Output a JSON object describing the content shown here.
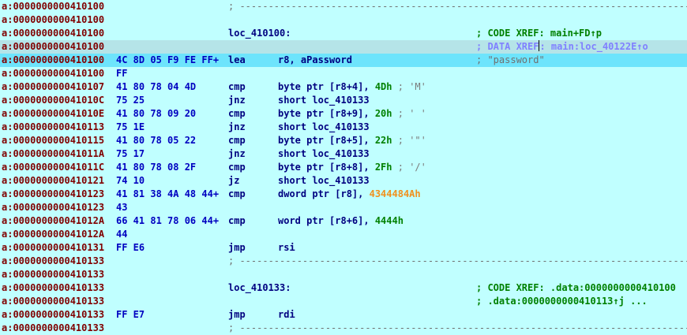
{
  "lines": [
    {
      "addr": "a:0000000000410100",
      "kind": "sep",
      "text": "; -----------------------------------------------------------------------------------"
    },
    {
      "addr": "a:0000000000410100"
    },
    {
      "addr": "a:0000000000410100",
      "label": "loc_410100:",
      "comment": "; CODE XREF: main+FD↑p"
    },
    {
      "addr": "a:0000000000410100",
      "comment_pre": "; DATA XREF",
      "comment_post": ": main:loc_40122E↑o",
      "comment_style": "dataxref",
      "highlight": "faint"
    },
    {
      "addr": "a:0000000000410100",
      "bytes": "4C 8D 05 F9 FE FF+",
      "mnem": "lea",
      "ops": "r8, aPassword",
      "comment": "; \"password\"",
      "comment_style": "gray",
      "highlight": "current"
    },
    {
      "addr": "a:0000000000410100",
      "bytes": "FF"
    },
    {
      "addr": "a:0000000000410107",
      "bytes": "41 80 78 04 4D",
      "mnem": "cmp",
      "ops": "byte ptr [r8+4], ",
      "imm": "4Dh",
      "inline": " ; 'M'"
    },
    {
      "addr": "a:000000000041010C",
      "bytes": "75 25",
      "mnem": "jnz",
      "ops": "short loc_410133"
    },
    {
      "addr": "a:000000000041010E",
      "bytes": "41 80 78 09 20",
      "mnem": "cmp",
      "ops": "byte ptr [r8+9], ",
      "imm": "20h",
      "inline": " ; ' '"
    },
    {
      "addr": "a:0000000000410113",
      "bytes": "75 1E",
      "mnem": "jnz",
      "ops": "short loc_410133"
    },
    {
      "addr": "a:0000000000410115",
      "bytes": "41 80 78 05 22",
      "mnem": "cmp",
      "ops": "byte ptr [r8+5], ",
      "imm": "22h",
      "inline": " ; '\"'"
    },
    {
      "addr": "a:000000000041011A",
      "bytes": "75 17",
      "mnem": "jnz",
      "ops": "short loc_410133"
    },
    {
      "addr": "a:000000000041011C",
      "bytes": "41 80 78 08 2F",
      "mnem": "cmp",
      "ops": "byte ptr [r8+8], ",
      "imm": "2Fh",
      "inline": " ; '/'"
    },
    {
      "addr": "a:0000000000410121",
      "bytes": "74 10",
      "mnem": "jz",
      "ops": "short loc_410133"
    },
    {
      "addr": "a:0000000000410123",
      "bytes": "41 81 38 4A 48 44+",
      "mnem": "cmp",
      "ops": "dword ptr [r8], ",
      "imm": "4344484Ah",
      "imm_style": "orange"
    },
    {
      "addr": "a:0000000000410123",
      "bytes": "43"
    },
    {
      "addr": "a:000000000041012A",
      "bytes": "66 41 81 78 06 44+",
      "mnem": "cmp",
      "ops": "word ptr [r8+6], ",
      "imm": "4444h"
    },
    {
      "addr": "a:000000000041012A",
      "bytes": "44"
    },
    {
      "addr": "a:0000000000410131",
      "bytes": "FF E6",
      "mnem": "jmp",
      "ops": "rsi"
    },
    {
      "addr": "a:0000000000410133",
      "kind": "sep",
      "text": "; -----------------------------------------------------------------------------------"
    },
    {
      "addr": "a:0000000000410133"
    },
    {
      "addr": "a:0000000000410133",
      "label": "loc_410133:",
      "comment": "; CODE XREF: .data:0000000000410100"
    },
    {
      "addr": "a:0000000000410133",
      "comment": "; .data:0000000000410113↑j ..."
    },
    {
      "addr": "a:0000000000410133",
      "bytes": "FF E7",
      "mnem": "jmp",
      "ops": "rdi"
    },
    {
      "addr": "a:0000000000410133",
      "kind": "sep",
      "text": "; -----------------------------------------------------------------------------------"
    }
  ]
}
